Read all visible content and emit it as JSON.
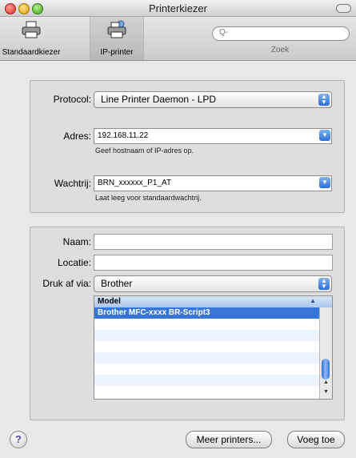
{
  "window": {
    "title": "Printerkiezer"
  },
  "toolbar": {
    "items": [
      {
        "label": "Standaardkiezer",
        "icon": "printer-icon"
      },
      {
        "label": "IP-printer",
        "icon": "network-printer-icon"
      }
    ],
    "search": {
      "placeholder": "Q-",
      "label": "Zoek"
    }
  },
  "connection": {
    "protocol_label": "Protocol:",
    "protocol_value": "Line Printer Daemon - LPD",
    "address_label": "Adres:",
    "address_value": "192.168.11.22",
    "address_hint": "Geef hostnaam of IP-adres op.",
    "queue_label": "Wachtrij:",
    "queue_value": "BRN_xxxxxx_P1_AT",
    "queue_hint": "Laat leeg voor standaardwachtrij."
  },
  "details": {
    "name_label": "Naam:",
    "name_value": "",
    "location_label": "Locatie:",
    "location_value": "",
    "print_via_label": "Druk af via:",
    "print_via_value": "Brother"
  },
  "model_list": {
    "header": "Model",
    "rows": [
      "Brother MFC-xxxx BR-Script3",
      "",
      "",
      "",
      "",
      "",
      "",
      ""
    ]
  },
  "footer": {
    "help": "?",
    "more_printers": "Meer printers...",
    "add": "Voeg toe"
  },
  "colors": {
    "selection": "#3875d7",
    "accent": "#2c6ed8"
  }
}
